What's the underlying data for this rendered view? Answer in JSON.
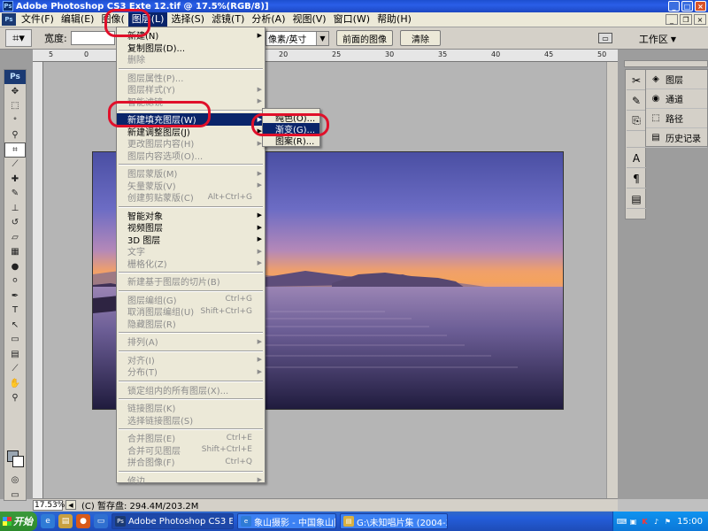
{
  "window": {
    "title": "Adobe Photoshop CS3 Extended - [12 12.tif @ 17.5%(RGB/8)]",
    "title_visible": "Adobe Photoshop CS3 Exte",
    "title_tail": "12.tif @ 17.5%(RGB/8)]",
    "min": "_",
    "max": "□",
    "close": "×"
  },
  "menubar": {
    "items": [
      "文件(F)",
      "编辑(E)",
      "图像(",
      "图层(L)",
      "选择(S)",
      "滤镜(T)",
      "分析(A)",
      "视图(V)",
      "窗口(W)",
      "帮助(H)"
    ],
    "active_index": 3
  },
  "options": {
    "width_label": "宽度:",
    "unit": "像素/英寸",
    "front_image": "前面的图像",
    "clear": "清除",
    "workspace": "工作区"
  },
  "layer_menu": {
    "items": [
      {
        "label": "新建(N)",
        "shortcut": "",
        "disabled": false,
        "sub": true
      },
      {
        "label": "复制图层(D)...",
        "shortcut": "",
        "disabled": false,
        "sub": false
      },
      {
        "label": "删除",
        "shortcut": "",
        "disabled": true,
        "sub": false
      },
      {
        "label": "图层属性(P)...",
        "shortcut": "",
        "disabled": true,
        "sub": false
      },
      {
        "label": "图层样式(Y)",
        "shortcut": "",
        "disabled": true,
        "sub": true
      },
      {
        "label": "智能滤镜",
        "shortcut": "",
        "disabled": true,
        "sub": true
      },
      {
        "label": "新建填充图层(W)",
        "shortcut": "",
        "disabled": false,
        "sub": true,
        "highlight": true
      },
      {
        "label": "新建调整图层(J)",
        "shortcut": "",
        "disabled": false,
        "sub": true
      },
      {
        "label": "更改图层内容(H)",
        "shortcut": "",
        "disabled": true,
        "sub": true
      },
      {
        "label": "图层内容选项(O)...",
        "shortcut": "",
        "disabled": true,
        "sub": false
      },
      {
        "label": "图层蒙版(M)",
        "shortcut": "",
        "disabled": true,
        "sub": true
      },
      {
        "label": "矢量蒙版(V)",
        "shortcut": "",
        "disabled": true,
        "sub": true
      },
      {
        "label": "创建剪贴蒙版(C)",
        "shortcut": "Alt+Ctrl+G",
        "disabled": true,
        "sub": false
      },
      {
        "label": "智能对象",
        "shortcut": "",
        "disabled": false,
        "sub": true
      },
      {
        "label": "视频图层",
        "shortcut": "",
        "disabled": false,
        "sub": true
      },
      {
        "label": "3D 图层",
        "shortcut": "",
        "disabled": false,
        "sub": true
      },
      {
        "label": "文字",
        "shortcut": "",
        "disabled": true,
        "sub": true
      },
      {
        "label": "栅格化(Z)",
        "shortcut": "",
        "disabled": true,
        "sub": true
      },
      {
        "label": "新建基于图层的切片(B)",
        "shortcut": "",
        "disabled": true,
        "sub": false
      },
      {
        "label": "图层编组(G)",
        "shortcut": "Ctrl+G",
        "disabled": true,
        "sub": false
      },
      {
        "label": "取消图层编组(U)",
        "shortcut": "Shift+Ctrl+G",
        "disabled": true,
        "sub": false
      },
      {
        "label": "隐藏图层(R)",
        "shortcut": "",
        "disabled": true,
        "sub": false
      },
      {
        "label": "排列(A)",
        "shortcut": "",
        "disabled": true,
        "sub": true
      },
      {
        "label": "对齐(I)",
        "shortcut": "",
        "disabled": true,
        "sub": true
      },
      {
        "label": "分布(T)",
        "shortcut": "",
        "disabled": true,
        "sub": true
      },
      {
        "label": "锁定组内的所有图层(X)...",
        "shortcut": "",
        "disabled": true,
        "sub": false
      },
      {
        "label": "链接图层(K)",
        "shortcut": "",
        "disabled": true,
        "sub": false
      },
      {
        "label": "选择链接图层(S)",
        "shortcut": "",
        "disabled": true,
        "sub": false
      },
      {
        "label": "合并图层(E)",
        "shortcut": "Ctrl+E",
        "disabled": true,
        "sub": false
      },
      {
        "label": "合并可见图层",
        "shortcut": "Shift+Ctrl+E",
        "disabled": true,
        "sub": false
      },
      {
        "label": "拼合图像(F)",
        "shortcut": "Ctrl+Q",
        "disabled": true,
        "sub": false
      },
      {
        "label": "修边",
        "shortcut": "",
        "disabled": true,
        "sub": true
      }
    ]
  },
  "fill_submenu": {
    "items": [
      "纯色(O)...",
      "渐变(G)...",
      "图案(R)..."
    ],
    "highlight_index": 1
  },
  "panels": {
    "layers": "图层",
    "channels": "通道",
    "paths": "路径",
    "history": "历史记录"
  },
  "statusbar": {
    "zoom": "17.53%",
    "info": "(C) 暂存盘: 294.4M/203.2M"
  },
  "taskbar": {
    "start": "开始",
    "tasks": [
      "Adobe Photoshop CS3 E...",
      "象山摄影 - 中国象山同...",
      "G:\\未知唱片集 (2004-3-..."
    ],
    "clock": "15:00"
  },
  "toolbox": {
    "logo": "Ps"
  }
}
